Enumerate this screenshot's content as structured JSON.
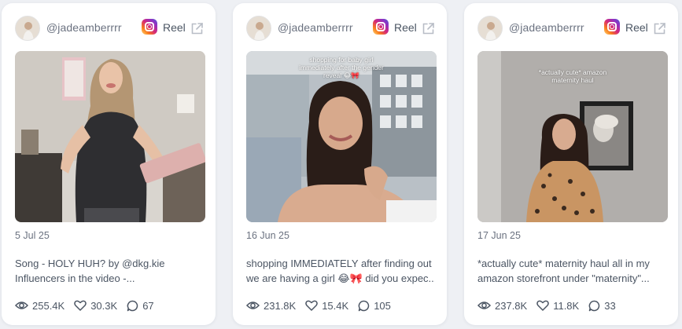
{
  "cards": [
    {
      "username": "@jadeamberrrr",
      "platform": "Reel",
      "date": "5 Jul 25",
      "overlay_text": "",
      "caption_line1": "Song - HOLY HUH? by @dkg.kie",
      "caption_line2": "Influencers in the video -...",
      "views": "255.4K",
      "likes": "30.3K",
      "comments": "67"
    },
    {
      "username": "@jadeamberrrr",
      "platform": "Reel",
      "date": "16 Jun 25",
      "overlay_text": "shopping for baby girl immediately after the gender reveal 😂🎀",
      "caption_line1": "shopping IMMEDIATELY after finding out",
      "caption_line2": "we are having a girl 😂🎀 did you expec...",
      "views": "231.8K",
      "likes": "15.4K",
      "comments": "105"
    },
    {
      "username": "@jadeamberrrr",
      "platform": "Reel",
      "date": "17 Jun 25",
      "overlay_text": "*actually cute* amazon maternity haul",
      "caption_line1": "*actually cute* maternity haul all in my",
      "caption_line2": "amazon storefront under \"maternity\"...",
      "views": "237.8K",
      "likes": "11.8K",
      "comments": "33"
    }
  ],
  "colors": {
    "background": "#eef0f4",
    "card": "#ffffff",
    "text_muted": "#6b7280",
    "text": "#4b5563"
  },
  "icons": {
    "platform": "instagram-icon",
    "external": "external-link-icon",
    "views": "eye-icon",
    "likes": "heart-icon",
    "comments": "comment-icon"
  }
}
